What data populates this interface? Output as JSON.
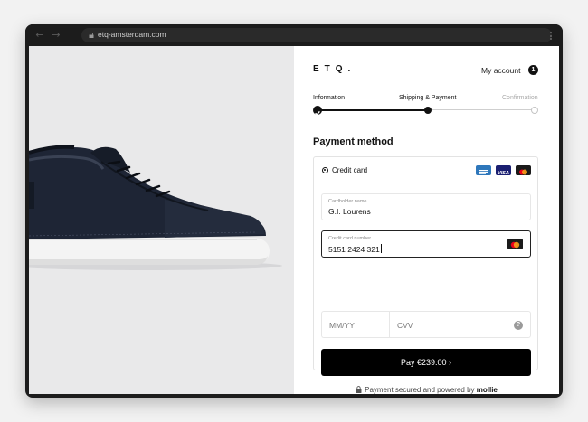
{
  "browser": {
    "url": "etq-amsterdam.com",
    "back_icon": "arrow-left-icon",
    "forward_icon": "arrow-right-icon",
    "menu_icon": "kebab-menu-icon"
  },
  "header": {
    "logo": "ETQ.",
    "account_label": "My account",
    "cart_count": "1"
  },
  "stepper": {
    "steps": [
      {
        "label": "Information",
        "state": "done"
      },
      {
        "label": "Shipping & Payment",
        "state": "current"
      },
      {
        "label": "Confirmation",
        "state": "todo"
      }
    ]
  },
  "payment": {
    "title": "Payment method",
    "method_label": "Credit card",
    "brands": [
      "amex",
      "visa",
      "mastercard"
    ],
    "cardholder": {
      "label": "Cardholder name",
      "value": "G.I. Lourens"
    },
    "card_number": {
      "label": "Credit card number",
      "value": "5151 2424 321"
    },
    "expiry": {
      "placeholder": "MM/YY"
    },
    "cvv": {
      "placeholder": "CVV"
    },
    "help_glyph": "?",
    "pay_label": "Pay €239.00 ›",
    "secured_text": "Payment secured and powered by",
    "provider": "mollie"
  },
  "colors": {
    "accent": "#000000",
    "amex": "#2e77bb",
    "visa": "#1a1f71",
    "mastercard_red": "#eb001b",
    "mastercard_yellow": "#f79e1b"
  }
}
